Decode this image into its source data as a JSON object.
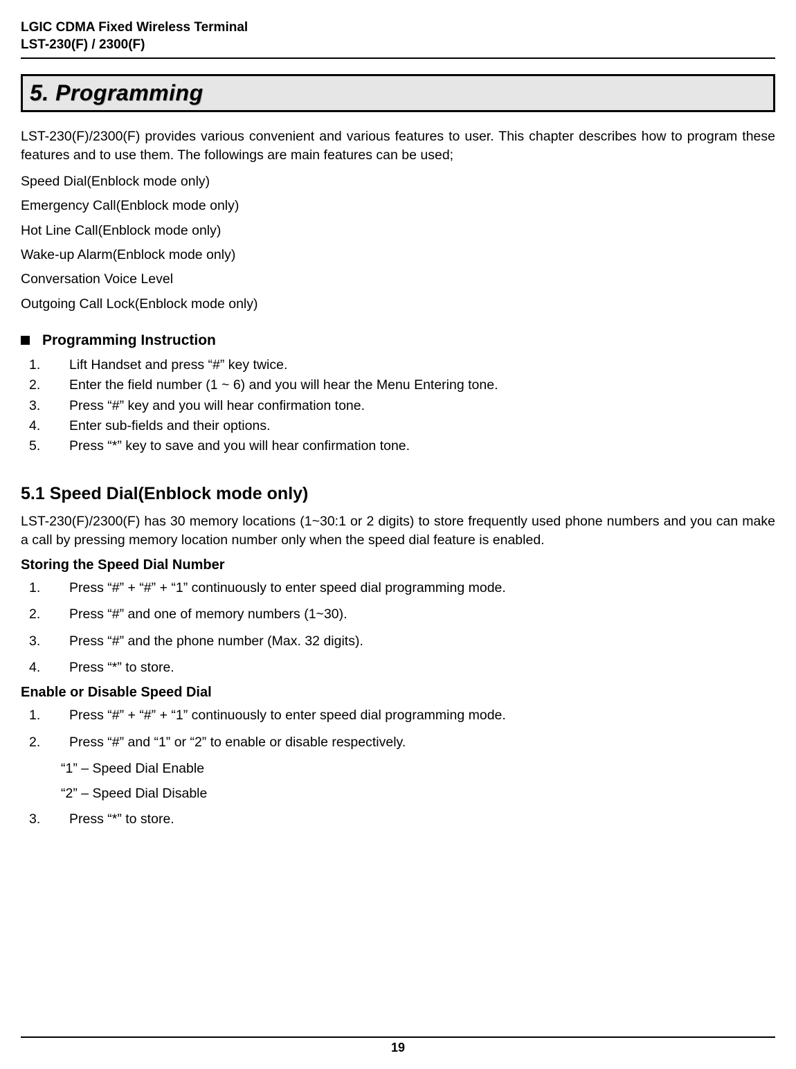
{
  "header": {
    "line1": "LGIC CDMA Fixed Wireless Terminal",
    "line2": "LST-230(F) / 2300(F)"
  },
  "section_title": "5.  Programming",
  "intro": "LST-230(F)/2300(F) provides various convenient and various features to user. This chapter describes how to program these features and to use them. The followings are main features can be used;",
  "features": [
    "Speed Dial(Enblock mode only)",
    "Emergency Call(Enblock mode only)",
    "Hot Line Call(Enblock mode only)",
    "Wake-up Alarm(Enblock mode only)",
    "Conversation Voice Level",
    "Outgoing Call Lock(Enblock mode only)"
  ],
  "prog_instruction_heading": "Programming Instruction",
  "prog_steps": [
    "Lift Handset and press “#” key twice.",
    "Enter the field number (1 ~ 6) and you will hear the Menu Entering tone.",
    "Press “#” key and you will hear confirmation tone.",
    "Enter sub-fields and their options.",
    "Press “*” key to save and you will hear confirmation tone."
  ],
  "sec51_heading": "5.1  Speed Dial(Enblock mode only)",
  "sec51_intro": "LST-230(F)/2300(F) has 30 memory locations (1~30:1 or 2 digits) to store frequently used phone numbers and you can make a call by pressing memory location number only when the speed dial feature is enabled.",
  "storing_heading": "Storing the Speed Dial Number",
  "storing_steps": [
    "Press “#” + “#” + “1” continuously to enter speed dial programming mode.",
    "Press “#” and one of memory numbers (1~30).",
    "Press “#” and the phone number (Max. 32 digits).",
    "Press “*” to store."
  ],
  "enable_heading": "Enable or Disable Speed Dial",
  "enable_steps": [
    "Press “#” + “#” + “1” continuously to enter speed dial programming mode.",
    "Press “#” and “1” or “2” to enable or disable respectively."
  ],
  "enable_sub1": "“1” – Speed Dial Enable",
  "enable_sub2": "“2” – Speed Dial Disable",
  "enable_step3": "Press “*” to store.",
  "page_number": "19"
}
